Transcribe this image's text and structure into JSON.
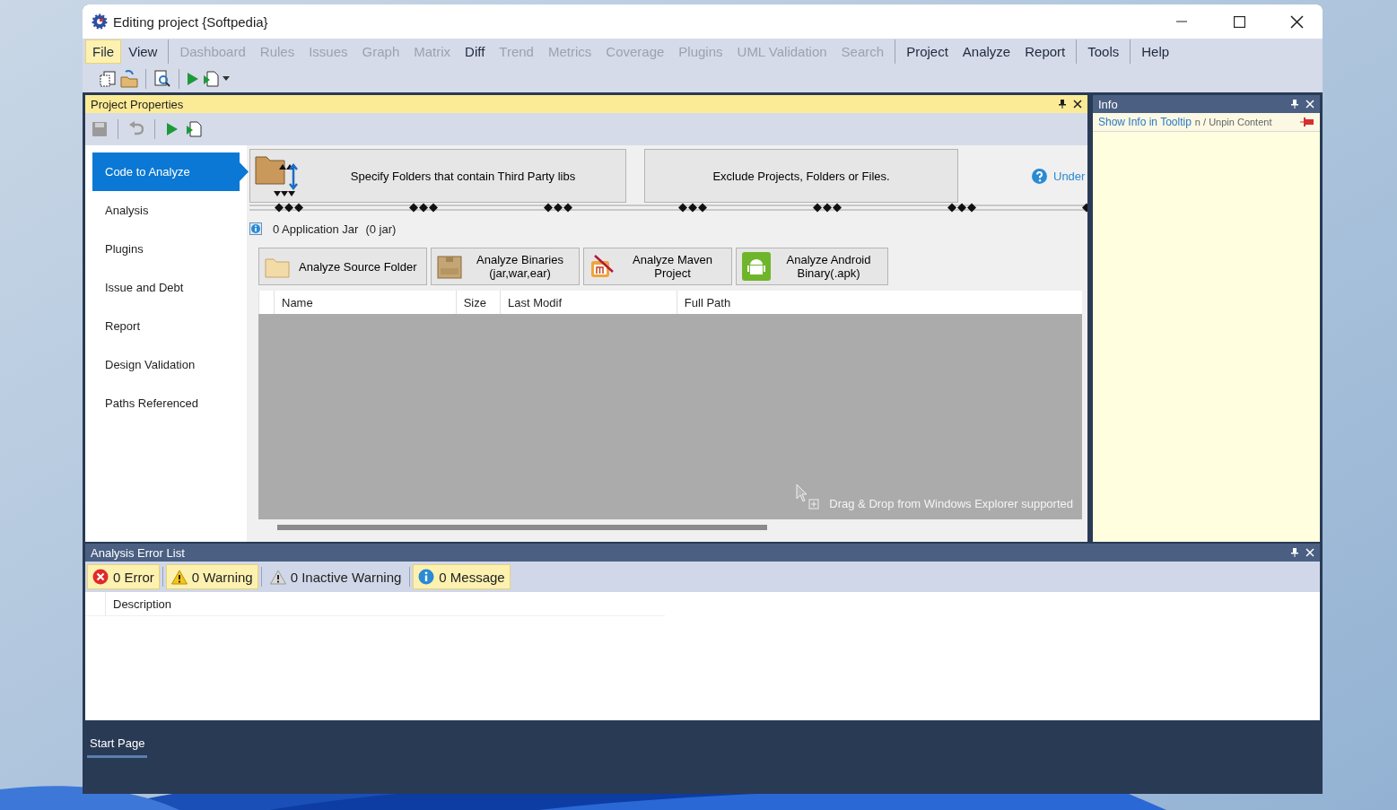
{
  "window": {
    "title": "Editing project {Softpedia}"
  },
  "menu_groups": [
    [
      {
        "label": "File",
        "disabled": false,
        "selected": true
      },
      {
        "label": "View",
        "disabled": false,
        "selected": false
      }
    ],
    [
      {
        "label": "Dashboard",
        "disabled": true,
        "selected": false
      },
      {
        "label": "Rules",
        "disabled": true,
        "selected": false
      },
      {
        "label": "Issues",
        "disabled": true,
        "selected": false
      },
      {
        "label": "Graph",
        "disabled": true,
        "selected": false
      },
      {
        "label": "Matrix",
        "disabled": true,
        "selected": false
      },
      {
        "label": "Diff",
        "disabled": false,
        "selected": false
      },
      {
        "label": "Trend",
        "disabled": true,
        "selected": false
      },
      {
        "label": "Metrics",
        "disabled": true,
        "selected": false
      },
      {
        "label": "Coverage",
        "disabled": true,
        "selected": false
      },
      {
        "label": "Plugins",
        "disabled": true,
        "selected": false
      },
      {
        "label": "UML Validation",
        "disabled": true,
        "selected": false
      },
      {
        "label": "Search",
        "disabled": true,
        "selected": false
      }
    ],
    [
      {
        "label": "Project",
        "disabled": false,
        "selected": false
      },
      {
        "label": "Analyze",
        "disabled": false,
        "selected": false
      },
      {
        "label": "Report",
        "disabled": false,
        "selected": false
      }
    ],
    [
      {
        "label": "Tools",
        "disabled": false,
        "selected": false
      }
    ],
    [
      {
        "label": "Help",
        "disabled": false,
        "selected": false
      }
    ]
  ],
  "project_properties": {
    "title": "Project Properties",
    "sidebar": {
      "items": [
        {
          "label": "Code to Analyze",
          "selected": true
        },
        {
          "label": "Analysis",
          "selected": false
        },
        {
          "label": "Plugins",
          "selected": false
        },
        {
          "label": "Issue and Debt",
          "selected": false
        },
        {
          "label": "Report",
          "selected": false
        },
        {
          "label": "Design Validation",
          "selected": false
        },
        {
          "label": "Paths Referenced",
          "selected": false
        }
      ]
    },
    "steps": [
      {
        "label": "Specify Folders that contain Third Party libs",
        "kind": "folders"
      },
      {
        "label": "Exclude Projects, Folders or Files.",
        "kind": "plain"
      }
    ],
    "help_link": "Under",
    "jar_count": "0 Application Jar",
    "jar_detail": "(0 jar)",
    "analyze_buttons": [
      {
        "label": "Analyze Source Folder",
        "kind": "folder"
      },
      {
        "label": "Analyze Binaries (jar,war,ear)",
        "kind": "jar"
      },
      {
        "label": "Analyze Maven Project",
        "kind": "maven"
      },
      {
        "label": "Analyze Android Binary(.apk)",
        "kind": "android"
      }
    ],
    "table": {
      "columns": [
        "Name",
        "Size",
        "Last Modif",
        "Full Path"
      ]
    },
    "drop_hint": "Drag & Drop from Windows Explorer supported"
  },
  "info": {
    "title": "Info",
    "link": "Show Info in Tooltip",
    "text": "n / Unpin Content"
  },
  "error_list": {
    "title": "Analysis Error List",
    "filters": [
      {
        "label": "0 Error",
        "kind": "error",
        "selected": true
      },
      {
        "label": "0 Warning",
        "kind": "warning",
        "selected": true
      },
      {
        "label": "0 Inactive Warning",
        "kind": "inactive",
        "selected": false
      },
      {
        "label": "0 Message",
        "kind": "message",
        "selected": true
      }
    ],
    "columns": [
      "Description"
    ]
  },
  "bottom_tabs": [
    {
      "label": "Start Page",
      "selected": true
    }
  ]
}
